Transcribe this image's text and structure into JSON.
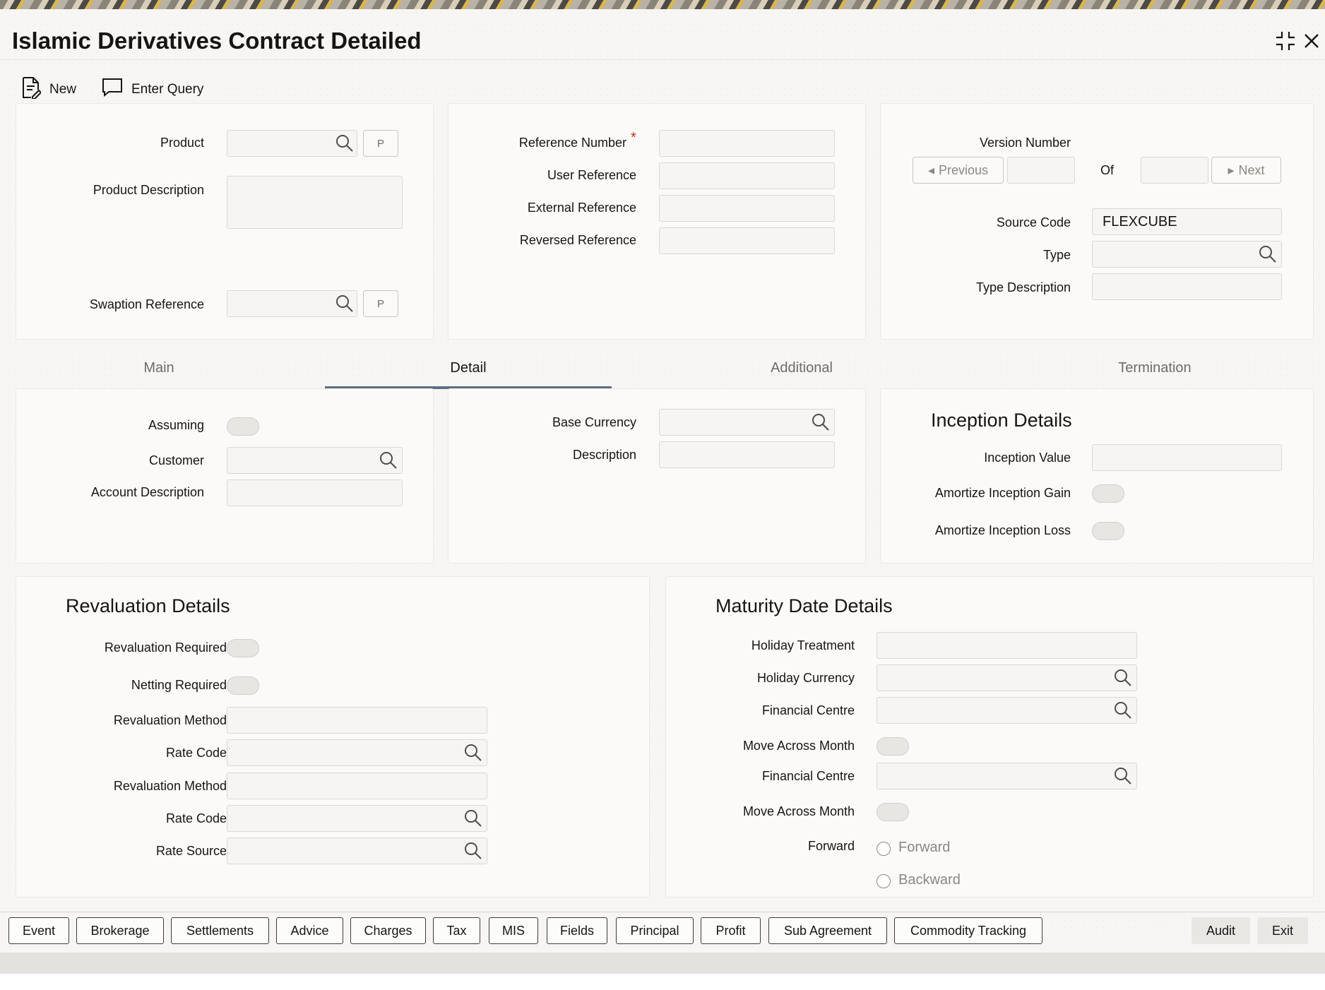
{
  "window": {
    "title": "Islamic Derivatives Contract Detailed"
  },
  "toolbar": {
    "new_label": "New",
    "enter_query_label": "Enter Query"
  },
  "header_left": {
    "product_label": "Product",
    "product_value": "",
    "product_p": "P",
    "product_description_label": "Product Description",
    "swaption_reference_label": "Swaption Reference",
    "swaption_p": "P"
  },
  "header_mid": {
    "reference_number_label": "Reference Number",
    "required_mark": "*",
    "user_reference_label": "User Reference",
    "external_reference_label": "External Reference",
    "reversed_reference_label": "Reversed Reference"
  },
  "header_right": {
    "version_number_label": "Version Number",
    "previous_label": "Previous",
    "of_label": "Of",
    "next_label": "Next",
    "source_code_label": "Source Code",
    "source_code_value": "FLEXCUBE",
    "type_label": "Type",
    "type_description_label": "Type Description"
  },
  "tabs": [
    {
      "label": "Main"
    },
    {
      "label": "Detail"
    },
    {
      "label": "Additional"
    },
    {
      "label": "Termination"
    }
  ],
  "detail_left": {
    "assuming_label": "Assuming",
    "customer_label": "Customer",
    "account_description_label": "Account Description"
  },
  "detail_mid": {
    "base_currency_label": "Base Currency",
    "description_label": "Description"
  },
  "inception": {
    "title": "Inception Details",
    "inception_value_label": "Inception Value",
    "amortize_gain_label": "Amortize Inception Gain",
    "amortize_loss_label": "Amortize Inception Loss"
  },
  "revaluation": {
    "title": "Revaluation Details",
    "revaluation_required_label": "Revaluation Required",
    "netting_required_label": "Netting Required",
    "revaluation_method_label_1": "Revaluation Method",
    "rate_code_label_1": "Rate Code",
    "revaluation_method_label_2": "Revaluation Method",
    "rate_code_label_2": "Rate Code",
    "rate_source_label": "Rate Source"
  },
  "maturity": {
    "title": "Maturity Date Details",
    "holiday_treatment_label": "Holiday Treatment",
    "holiday_currency_label": "Holiday Currency",
    "financial_centre_label_1": "Financial Centre",
    "move_across_month_label_1": "Move Across Month",
    "financial_centre_label_2": "Financial Centre",
    "move_across_month_label_2": "Move Across Month",
    "forward_label": "Forward",
    "radio_forward": "Forward",
    "radio_backward": "Backward"
  },
  "footer": {
    "buttons": [
      "Event",
      "Brokerage",
      "Settlements",
      "Advice",
      "Charges",
      "Tax",
      "MIS",
      "Fields",
      "Principal",
      "Profit",
      "Sub Agreement",
      "Commodity Tracking"
    ],
    "audit_label": "Audit",
    "exit_label": "Exit"
  },
  "icons": {
    "search": "search-icon",
    "new": "new-document-icon",
    "enter_query": "chat-bubble-icon",
    "maximize": "collapse-arrows-icon",
    "close": "close-icon"
  }
}
